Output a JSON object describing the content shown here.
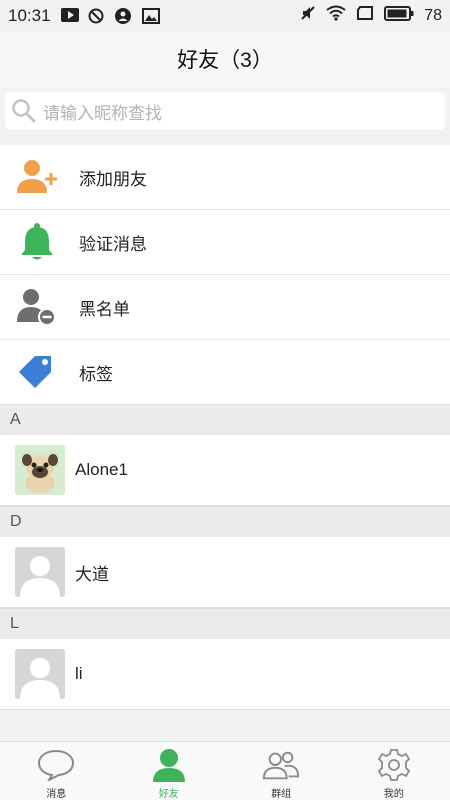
{
  "status_bar": {
    "time": "10:31",
    "battery": "78"
  },
  "header": {
    "title": "好友（3）"
  },
  "search": {
    "placeholder": "请输入昵称查找"
  },
  "menu": [
    {
      "label": "添加朋友",
      "icon": "add-friend-icon"
    },
    {
      "label": "验证消息",
      "icon": "bell-icon"
    },
    {
      "label": "黑名单",
      "icon": "block-user-icon"
    },
    {
      "label": "标签",
      "icon": "tag-icon"
    }
  ],
  "contacts": [
    {
      "section": "A",
      "name": "Alone1",
      "avatar": "pug-avatar"
    },
    {
      "section": "D",
      "name": "大道",
      "avatar": "default-avatar"
    },
    {
      "section": "L",
      "name": "li",
      "avatar": "default-avatar"
    }
  ],
  "tabs": [
    {
      "label": "消息",
      "icon": "chat-bubble-icon",
      "active": false
    },
    {
      "label": "好友",
      "icon": "person-icon",
      "active": true
    },
    {
      "label": "群组",
      "icon": "group-icon",
      "active": false
    },
    {
      "label": "我的",
      "icon": "gear-icon",
      "active": false
    }
  ],
  "colors": {
    "accent": "#3db35a",
    "orange": "#f0a04b",
    "blue": "#3d7fd6",
    "gray": "#6e6e6e"
  }
}
